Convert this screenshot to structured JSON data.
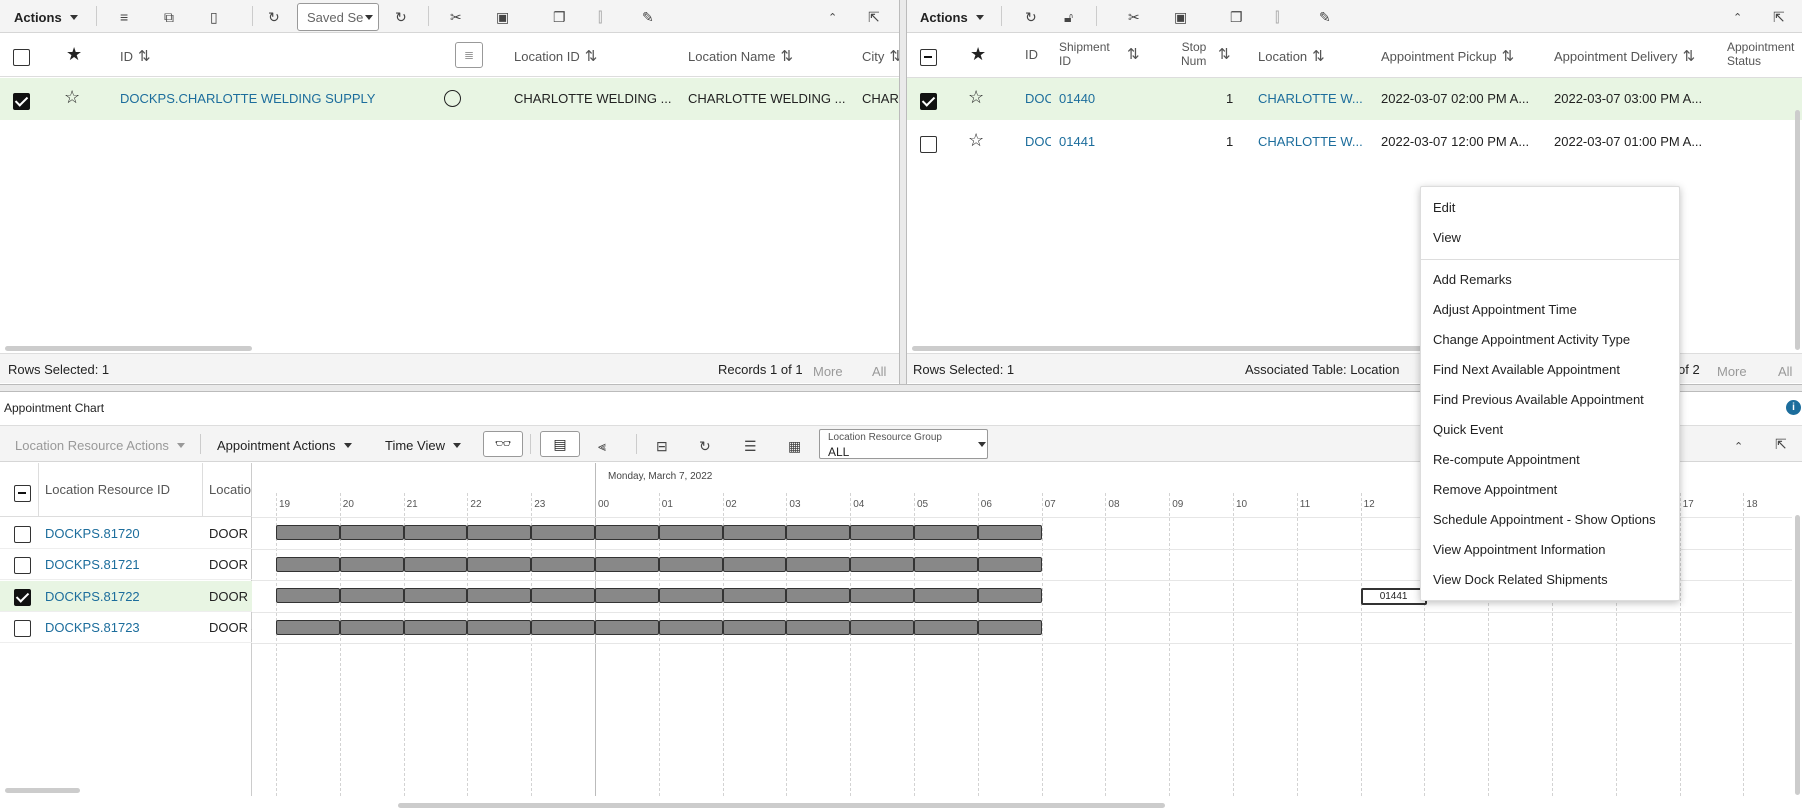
{
  "left_panel": {
    "toolbar": {
      "actions_label": "Actions",
      "saved_search_placeholder": "Saved Se"
    },
    "columns": [
      "ID",
      "Location ID",
      "Location Name",
      "City"
    ],
    "rows": [
      {
        "id": "DOCKPS.CHARLOTTE WELDING SUPPLY",
        "location_id": "CHARLOTTE WELDING ...",
        "location_name": "CHARLOTTE WELDING ...",
        "city": "CHARL",
        "selected": true
      }
    ],
    "footer": {
      "rows_selected": "Rows Selected: 1",
      "records": "Records 1 of 1",
      "more": "More",
      "all": "All"
    }
  },
  "right_panel": {
    "toolbar": {
      "actions_label": "Actions"
    },
    "columns": {
      "id": "ID",
      "shipment_id_1": "Shipment",
      "shipment_id_2": "ID",
      "stop_num_1": "Stop",
      "stop_num_2": "Num",
      "location": "Location",
      "appt_pickup": "Appointment Pickup",
      "appt_delivery": "Appointment Delivery",
      "appt_status_1": "Appointment",
      "appt_status_2": "Status"
    },
    "rows": [
      {
        "id": "DOC",
        "shipment_id": "01440",
        "stop_num": "1",
        "location": "CHARLOTTE W...",
        "pickup": "2022-03-07 02:00 PM A...",
        "delivery": "2022-03-07 03:00 PM A...",
        "selected": true
      },
      {
        "id": "DOC",
        "shipment_id": "01441",
        "stop_num": "1",
        "location": "CHARLOTTE W...",
        "pickup": "2022-03-07 12:00 PM A...",
        "delivery": "2022-03-07 01:00 PM A...",
        "selected": false
      }
    ],
    "footer": {
      "rows_selected": "Rows Selected: 1",
      "associated_table": "Associated Table: Location",
      "records_partial": "of 2",
      "more": "More",
      "all": "All"
    }
  },
  "context_menu": {
    "group1": [
      "Edit",
      "View"
    ],
    "group2": [
      "Add Remarks",
      "Adjust Appointment Time",
      "Change Appointment Activity Type",
      "Find Next Available Appointment",
      "Find Previous Available Appointment",
      "Quick Event",
      "Re-compute Appointment",
      "Remove Appointment",
      "Schedule Appointment - Show Options",
      "View Appointment Information",
      "View Dock Related Shipments"
    ]
  },
  "chart": {
    "title": "Appointment Chart",
    "toolbar": {
      "location_resource_actions": "Location Resource Actions",
      "appointment_actions": "Appointment Actions",
      "time_view": "Time View",
      "resource_group_label": "Location Resource Group",
      "resource_group_value": "ALL"
    },
    "columns": {
      "resource_id": "Location Resource ID",
      "location": "Locatio"
    },
    "date_label": "Monday, March 7, 2022",
    "hours": [
      "19",
      "20",
      "21",
      "22",
      "23",
      "00",
      "01",
      "02",
      "03",
      "04",
      "05",
      "06",
      "07",
      "08",
      "09",
      "10",
      "11",
      "12",
      "13",
      "14",
      "15",
      "16",
      "17",
      "18"
    ],
    "rows": [
      {
        "id": "DOCKPS.81720",
        "door": "DOOR 1",
        "selected": false
      },
      {
        "id": "DOCKPS.81721",
        "door": "DOOR 2",
        "selected": false
      },
      {
        "id": "DOCKPS.81722",
        "door": "DOOR 3",
        "selected": true
      },
      {
        "id": "DOCKPS.81723",
        "door": "DOOR 4",
        "selected": false
      }
    ],
    "appointment_label": "01441"
  }
}
